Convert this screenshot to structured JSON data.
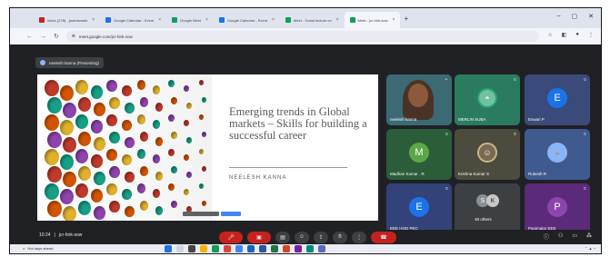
{
  "browser": {
    "tabs": [
      {
        "label": "Inbox (278) - janedwards",
        "favicon_color": "#c5221f",
        "active": false
      },
      {
        "label": "Google Calendar - Event",
        "favicon_color": "#1a73e8",
        "active": false
      },
      {
        "label": "Google Meet",
        "favicon_color": "#0f9d58",
        "active": false
      },
      {
        "label": "Google Calendar - Event",
        "favicon_color": "#1a73e8",
        "active": false
      },
      {
        "label": "Meet - Guest lecture on",
        "favicon_color": "#0f9d58",
        "active": false
      },
      {
        "label": "Meet - jcr-hirk-sow",
        "favicon_color": "#0f9d58",
        "active": true
      }
    ],
    "url": "meet.google.com/jcr-hirk-sow"
  },
  "meet": {
    "presenter_chip": "neelesh kanna (Presenting)",
    "slide": {
      "title": "Emerging trends in Global markets – Skills for building a successful career",
      "author": "NEELESH KANNA"
    },
    "participants": [
      {
        "name": "neelesh kanna",
        "type": "video",
        "color": "#3b6a74"
      },
      {
        "name": "MERLIN SUBA",
        "type": "image",
        "color": "#27a37a"
      },
      {
        "name": "Eswari P",
        "type": "letter",
        "letter": "E",
        "color": "#1a73e8",
        "bg": "#3a4a7a"
      },
      {
        "name": "Madhan Kumar . R",
        "type": "letter",
        "letter": "M",
        "color": "#5aa845",
        "bg": "#2b5d3a"
      },
      {
        "name": "Krishna Kumar S",
        "type": "image",
        "color": "#5a4a3a",
        "bg": "#4b4b3e"
      },
      {
        "name": "Rubesh R",
        "type": "image",
        "color": "#8ab4f8",
        "bg": "#3f5a8e"
      },
      {
        "name": "EEE HOD PEC",
        "type": "letter",
        "letter": "E",
        "color": "#1a73e8",
        "bg": "#34427a"
      },
      {
        "name": "48 others",
        "type": "others",
        "color": "#5f6368",
        "bg": "#3c4043"
      },
      {
        "name": "Panimalar EEE",
        "type": "letter",
        "letter": "P",
        "color": "#8e44ad",
        "bg": "#5b2a7a"
      }
    ]
  },
  "controls": {
    "time": "10:24",
    "meeting_code": "jcr-hirk-sow"
  },
  "taskbar": {
    "weather": "Hot days ahead"
  }
}
